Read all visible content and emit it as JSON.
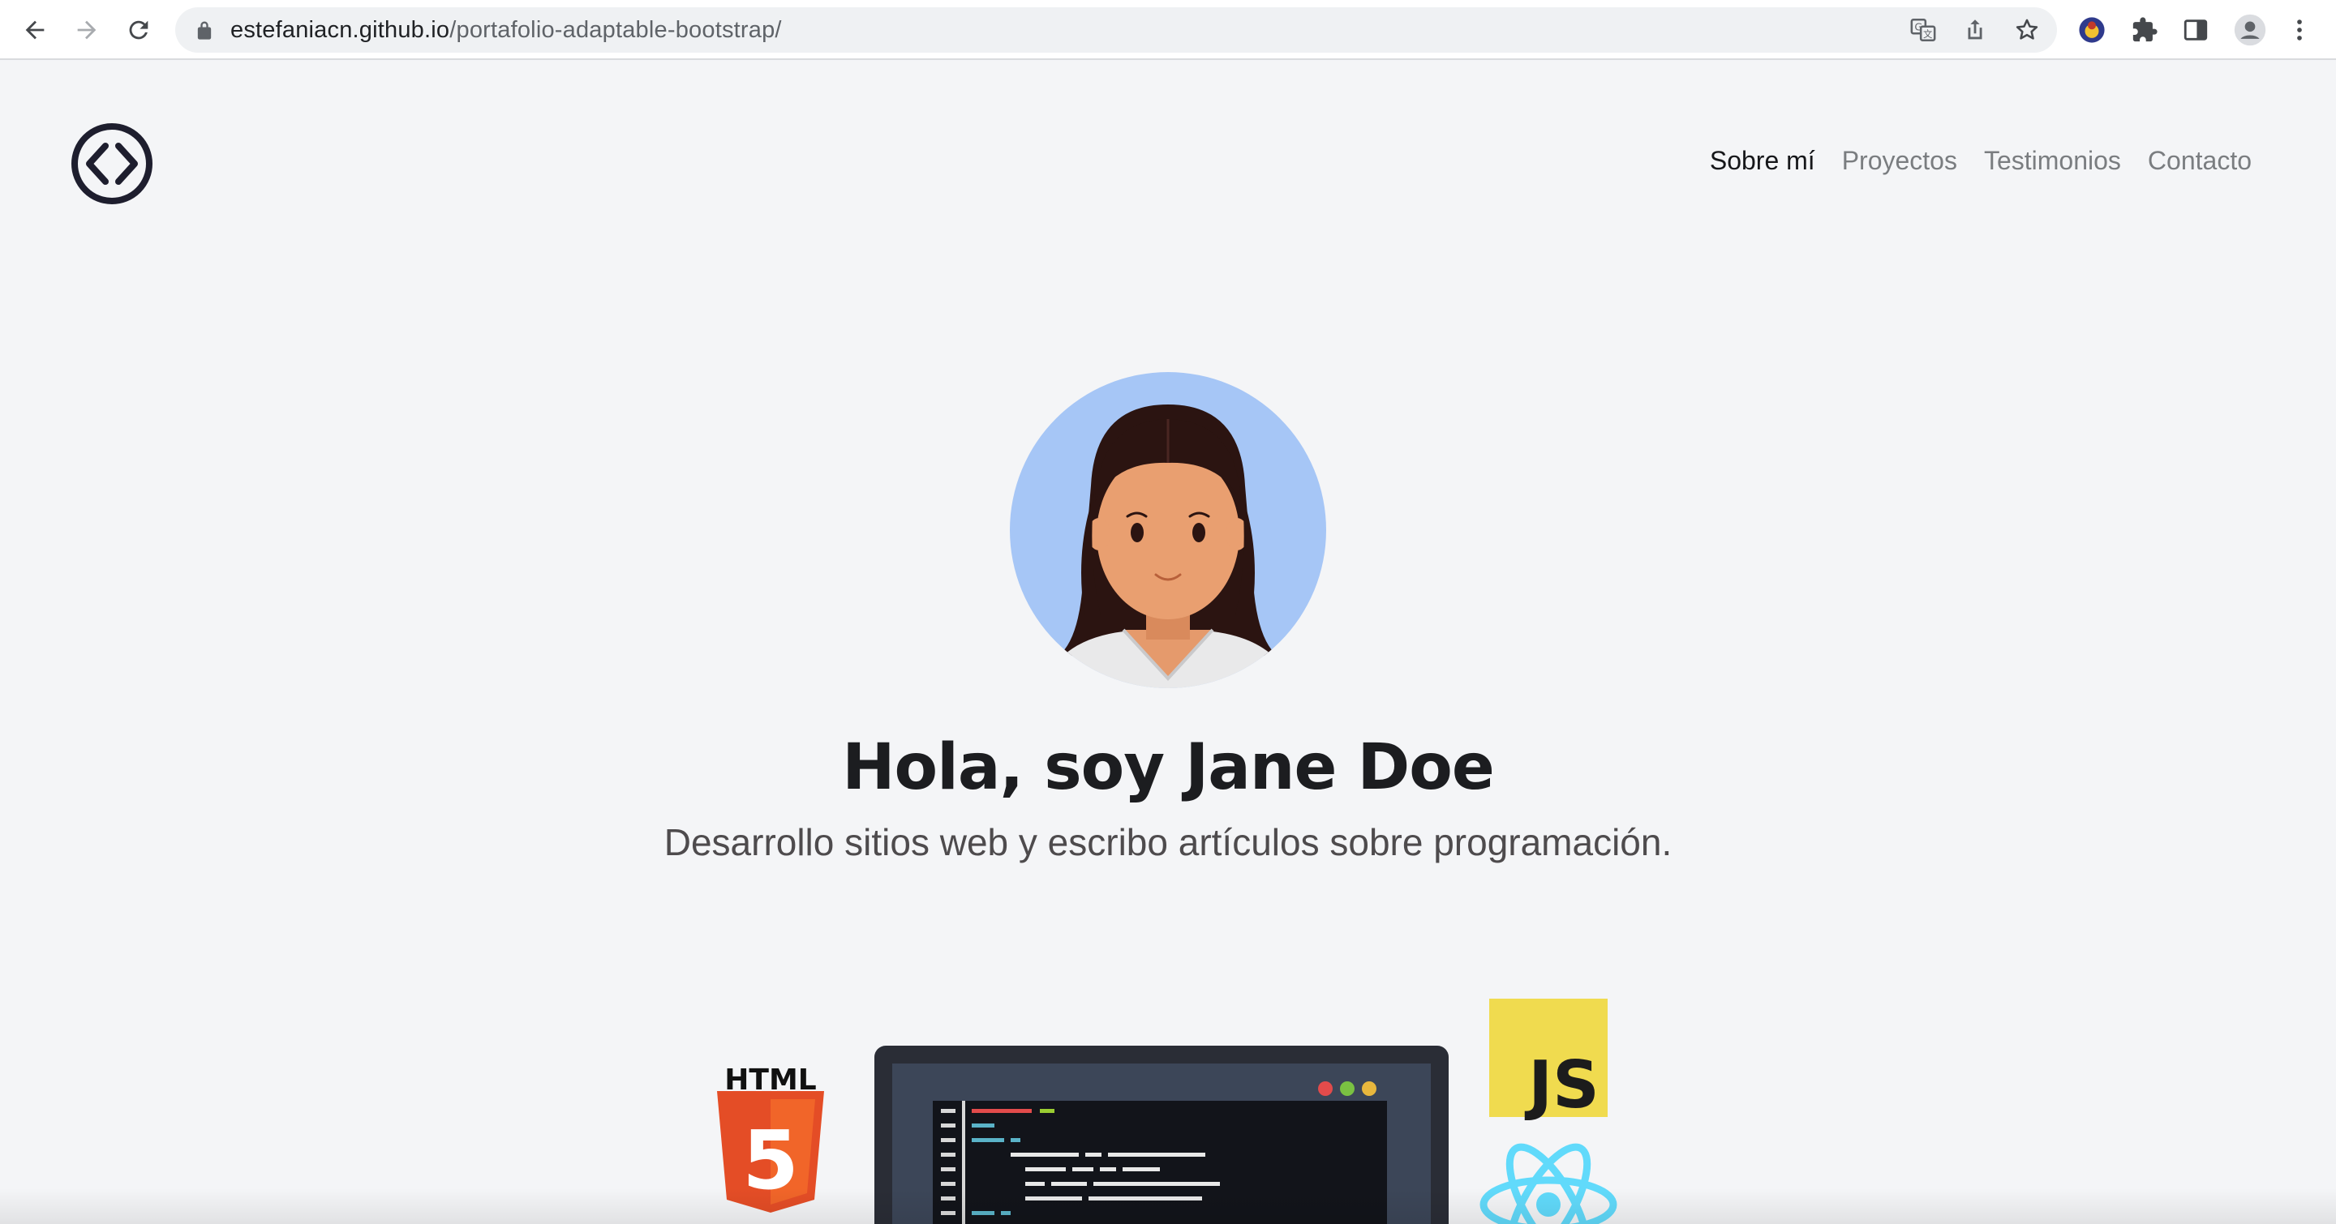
{
  "browser": {
    "url_host": "estefaniacn.github.io",
    "url_path": "/portafolio-adaptable-bootstrap/",
    "icons": [
      "back-icon",
      "forward-icon",
      "reload-icon",
      "lock-icon",
      "translate-icon",
      "share-icon",
      "bookmark-star-icon",
      "extension-avatar-icon",
      "puzzle-icon",
      "side-panel-icon",
      "profile-icon",
      "more-icon"
    ]
  },
  "site": {
    "logo_icon": "code-brackets-icon",
    "nav": [
      {
        "label": "Sobre mí",
        "active": true
      },
      {
        "label": "Proyectos",
        "active": false
      },
      {
        "label": "Testimonios",
        "active": false
      },
      {
        "label": "Contacto",
        "active": false
      }
    ]
  },
  "hero": {
    "title": "Hola, soy Jane Doe",
    "subtitle": "Desarrollo sitios web y escribo artículos sobre programación."
  },
  "tech_logos": {
    "html_label": "HTML",
    "html_number": "5",
    "js_label": "JS"
  },
  "colors": {
    "page_bg": "#f4f5f7",
    "avatar_bg": "#a6c6f6",
    "html5_orange": "#e44d26",
    "js_yellow": "#f0db4f",
    "react_blue": "#61dafb"
  }
}
